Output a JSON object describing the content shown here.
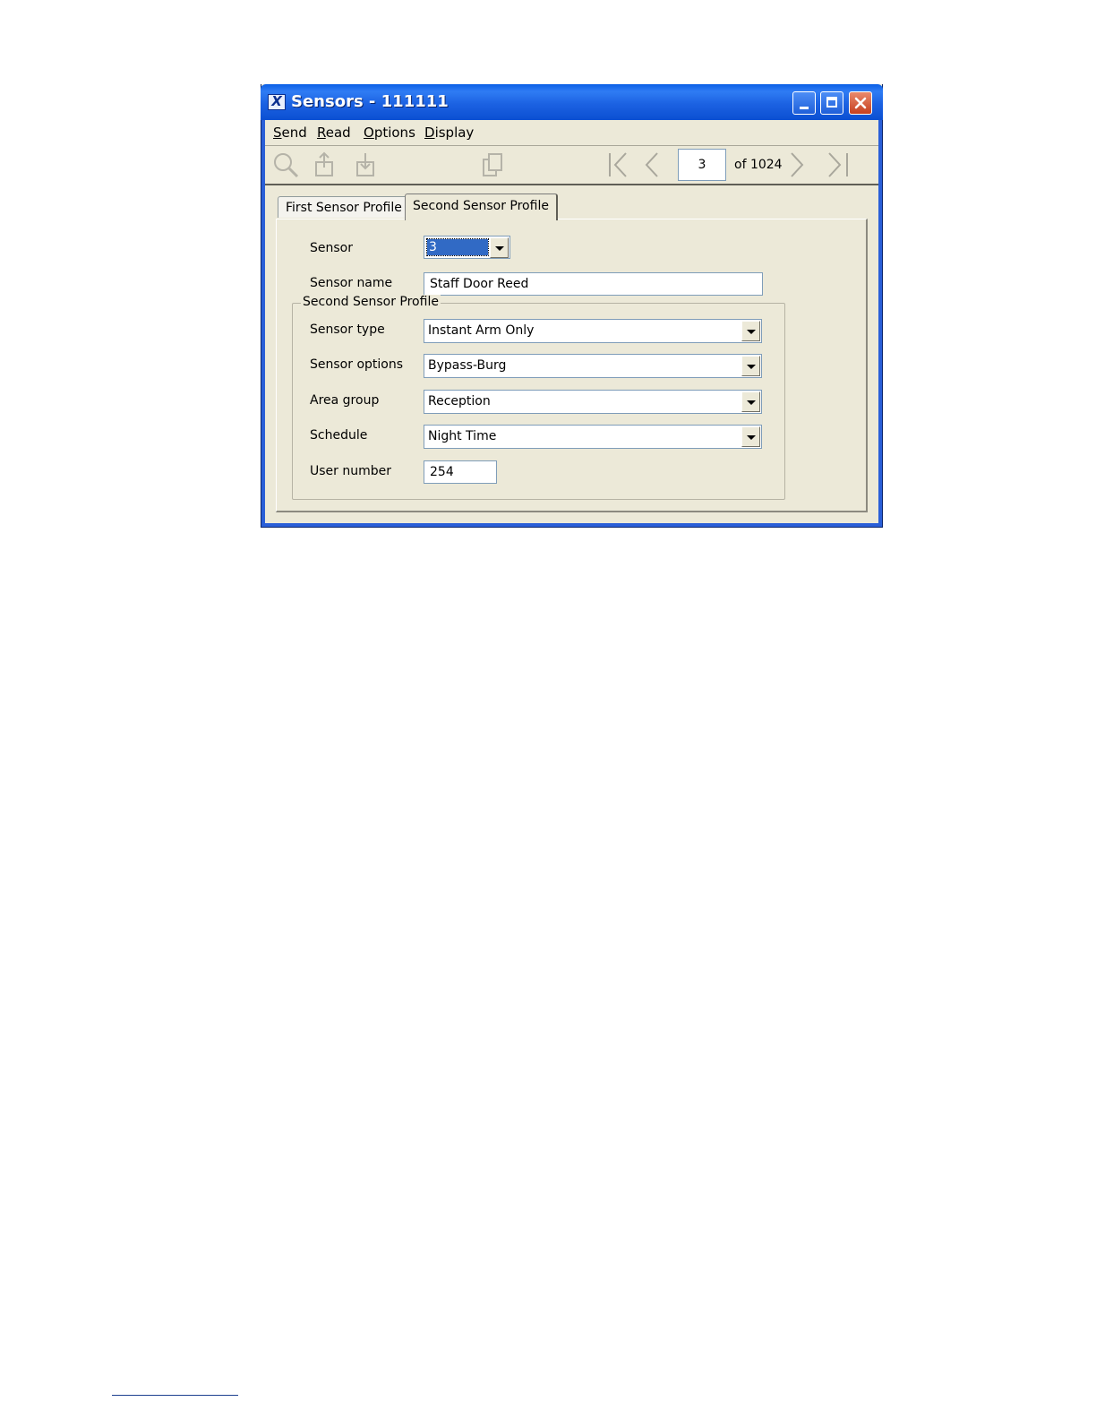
{
  "window": {
    "title": "Sensors - 111111"
  },
  "menu": {
    "items": [
      "Send",
      "Read",
      "Options",
      "Display"
    ]
  },
  "toolbar": {
    "icons": [
      "search-icon",
      "send-icon",
      "read-icon",
      "copy-icon",
      "first-record-icon",
      "previous-record-icon",
      "next-record-icon",
      "last-record-icon"
    ],
    "page_value": "3",
    "page_total_label": "of 1024"
  },
  "tabs": {
    "first": "First Sensor Profile",
    "second": "Second Sensor Profile"
  },
  "form": {
    "sensor_label": "Sensor",
    "sensor_value": "3",
    "sensor_name_label": "Sensor name",
    "sensor_name_value": "Staff Door Reed",
    "group_title": "Second Sensor Profile",
    "sensor_type_label": "Sensor type",
    "sensor_type_value": "Instant Arm Only",
    "sensor_options_label": "Sensor options",
    "sensor_options_value": "Bypass-Burg",
    "area_group_label": "Area group",
    "area_group_value": "Reception",
    "schedule_label": "Schedule",
    "schedule_value": "Night Time",
    "user_number_label": "User number",
    "user_number_value": "254"
  }
}
